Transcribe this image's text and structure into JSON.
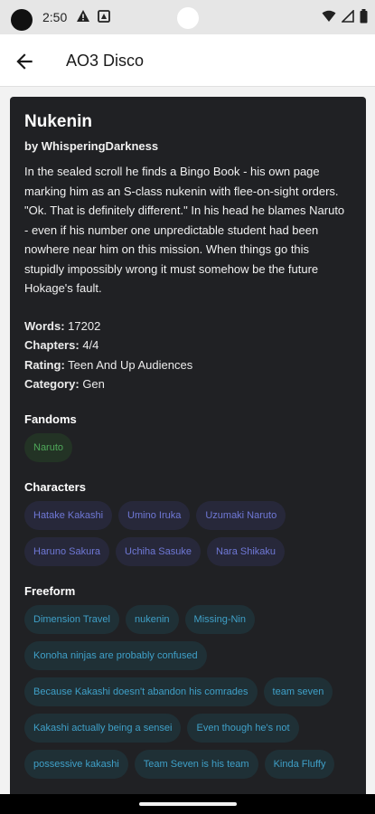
{
  "status_bar": {
    "time": "2:50",
    "icons": [
      "camera-dot",
      "warning-icon",
      "notification-icon",
      "wifi-icon",
      "signal-icon",
      "battery-icon"
    ]
  },
  "app_bar": {
    "title": "AO3 Disco",
    "back_icon": "arrow-left-icon"
  },
  "work": {
    "title": "Nukenin",
    "author": "by WhisperingDarkness",
    "summary": "In the sealed scroll he finds a Bingo Book - his own page marking him as an S-class nukenin with flee-on-sight orders. \"Ok. That is definitely different.\" In his head he blames Naruto - even if his number one unpredictable student had been nowhere near him on this mission. When things go this stupidly impossibly wrong it must somehow be the future Hokage's fault.",
    "stats": {
      "words_label": "Words:",
      "words": "17202",
      "chapters_label": "Chapters:",
      "chapters": "4/4",
      "rating_label": "Rating:",
      "rating": "Teen And Up Audiences",
      "category_label": "Category:",
      "category": "Gen"
    },
    "fandoms_heading": "Fandoms",
    "fandoms": [
      "Naruto"
    ],
    "characters_heading": "Characters",
    "characters": [
      "Hatake Kakashi",
      "Umino Iruka",
      "Uzumaki Naruto",
      "Haruno Sakura",
      "Uchiha Sasuke",
      "Nara Shikaku"
    ],
    "freeform_heading": "Freeform",
    "freeform": [
      "Dimension Travel",
      "nukenin",
      "Missing-Nin",
      "Konoha ninjas are probably confused",
      "Because Kakashi doesn't abandon his comrades",
      "team seven",
      "Kakashi actually being a sensei",
      "Even though he's not",
      "possessive kakashi",
      "Team Seven is his team",
      "Kinda Fluffy"
    ]
  },
  "colors": {
    "card_bg": "#202124",
    "fandom_tag": "#4fa85a",
    "character_tag": "#6f78d6",
    "freeform_tag": "#3fa0c8"
  }
}
